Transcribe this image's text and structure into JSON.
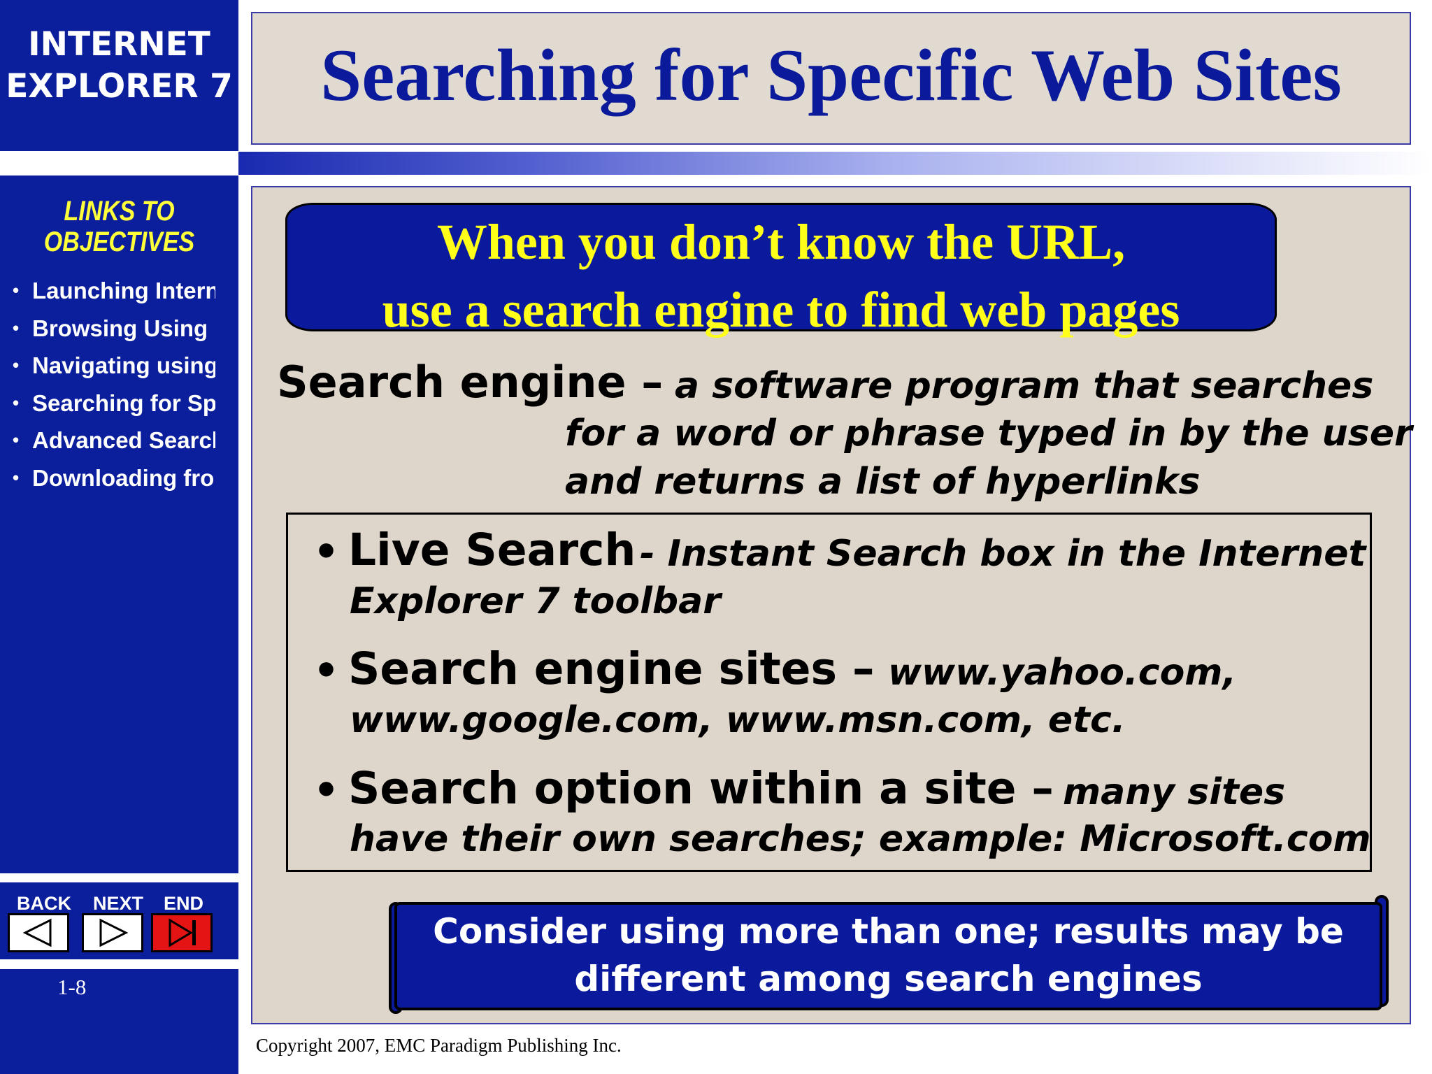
{
  "sidebar": {
    "app_title_line1": "INTERNET",
    "app_title_line2": "EXPLORER 7",
    "links_heading_line1": "LINKS TO",
    "links_heading_line2": "OBJECTIVES",
    "objectives": [
      {
        "label": "Launching Interne"
      },
      {
        "label": "Browsing Using UI"
      },
      {
        "label": "Navigating using h"
      },
      {
        "label": "Searching for Spec"
      },
      {
        "label": "Advanced Searche"
      },
      {
        "label": "Downloading from"
      }
    ],
    "bullet": "•",
    "nav": {
      "back_label": "BACK",
      "next_label": "NEXT",
      "end_label": "END",
      "back_icon": "triangle-left-icon",
      "next_icon": "triangle-right-icon",
      "end_icon": "skip-to-end-icon"
    },
    "page_number": "1-8"
  },
  "slide": {
    "title": "Searching for Specific Web Sites",
    "banner_line1": "When you don’t know the URL,",
    "banner_line2": "use a search engine to find web pages",
    "definition": {
      "term": "Search engine –",
      "line1": "a software program that searches",
      "line2": "for a word or phrase typed in by the user",
      "line3": "and returns a list of hyperlinks"
    },
    "bullet_char": "•",
    "bullets": [
      {
        "title": "Live Search",
        "desc_line1": "- Instant Search box in the Internet",
        "desc_line2": "Explorer 7 toolbar"
      },
      {
        "title": "Search engine sites  –",
        "desc_line1": "www.yahoo.com,",
        "desc_line2": "www.google.com, www.msn.com, etc."
      },
      {
        "title": "Search option within a site  –",
        "desc_line1": "many sites",
        "desc_line2": "have their own searches; example: Microsoft.com"
      }
    ],
    "note_line1": "Consider using more than one; results may be",
    "note_line2": "different among search engines",
    "copyright": "Copyright 2007, EMC Paradigm Publishing Inc."
  },
  "colors": {
    "sidebar_blue": "#0b1e9c",
    "title_blue": "#0b1a9a",
    "banner_yellow": "#ffff1a",
    "objectives_yellow": "#ffff3a",
    "panel_beige": "#ded6cb",
    "end_button_red": "#e51414"
  }
}
